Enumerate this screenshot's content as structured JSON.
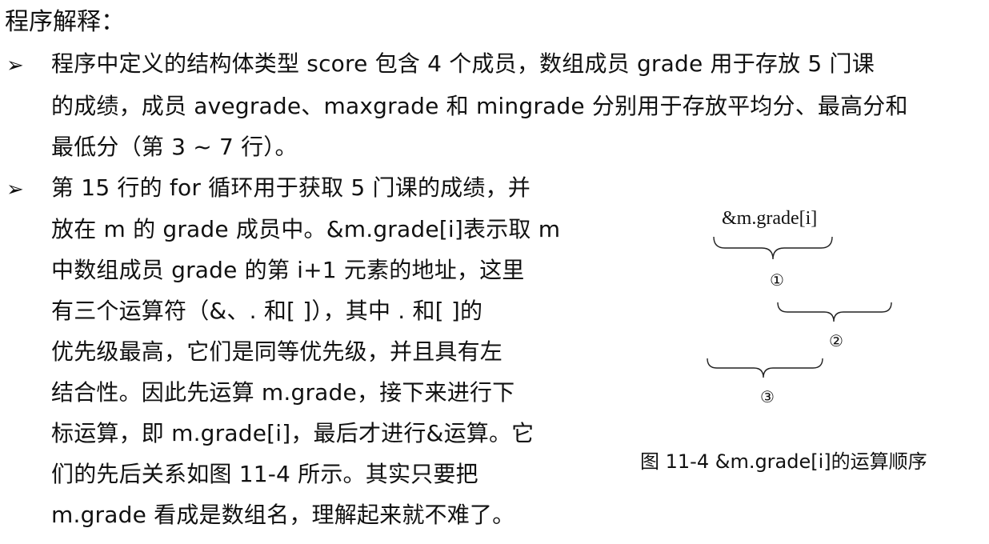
{
  "heading": "程序解释：",
  "bullets": [
    {
      "marker": "➢",
      "lines": [
        "程序中定义的结构体类型 score 包含 4 个成员，数组成员 grade 用于存放 5 门课",
        "的成绩，成员 avegrade、maxgrade 和 mingrade 分别用于存放平均分、最高分和",
        "最低分（第 3 ~ 7 行）。"
      ]
    },
    {
      "marker": "➢",
      "lines": [
        "第 15 行的 for 循环用于获取 5 门课的成绩，并",
        "放在 m 的 grade 成员中。&m.grade[i]表示取 m",
        "中数组成员 grade 的第 i+1 元素的地址，这里",
        "有三个运算符（&、. 和[ ]），其中 . 和[ ]的",
        "优先级最高，它们是同等优先级，并且具有左",
        "结合性。因此先运算 m.grade，接下来进行下",
        "标运算，即 m.grade[i]，最后才进行&运算。它",
        "们的先后关系如图 11-4 所示。其实只要把",
        "m.grade 看成是数组名，理解起来就不难了。"
      ]
    }
  ],
  "figure": {
    "expression": "&m.grade[i]",
    "marks": [
      "①",
      "②",
      "③"
    ],
    "caption": "图 11-4    &m.grade[i]的运算顺序"
  }
}
